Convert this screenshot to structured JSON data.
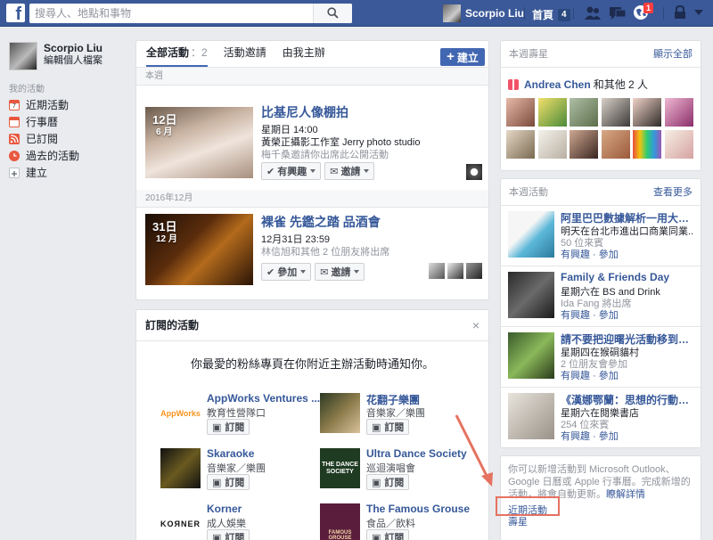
{
  "topbar": {
    "logo": "f",
    "search_placeholder": "搜尋人、地點和事物",
    "user_name": "Scorpio Liu",
    "home_label": "首頁",
    "home_count": "4",
    "notif_count": "1"
  },
  "sidebar": {
    "user_name": "Scorpio Liu",
    "edit_profile": "編輯個人檔案",
    "heading": "我的活動",
    "items": [
      {
        "label": "近期活動",
        "icon": "calendar-today-icon",
        "color": "#e9573f"
      },
      {
        "label": "行事曆",
        "icon": "calendar-icon",
        "color": "#e9573f"
      },
      {
        "label": "已訂閱",
        "icon": "rss-icon",
        "color": "#e9573f"
      },
      {
        "label": "過去的活動",
        "icon": "clock-icon",
        "color": "#e9573f"
      },
      {
        "label": "建立",
        "icon": "plus-icon",
        "color": "#90949c"
      }
    ]
  },
  "main": {
    "tabs": [
      {
        "label": "全部活動",
        "count": "：2"
      },
      {
        "label": "活動邀請",
        "count": ""
      },
      {
        "label": "由我主辦",
        "count": ""
      }
    ],
    "create_label": "建立",
    "sections": [
      {
        "label": "本週",
        "event": {
          "day": "12日",
          "month": "6 月",
          "title": "比基尼人像棚拍",
          "time": "星期日 14:00",
          "place": "黃榮正攝影工作室 Jerry photo studio",
          "invite": "梅千桑邀請你出席此公開活動",
          "btn1": "有興趣",
          "btn2": "邀請"
        }
      },
      {
        "label": "2016年12月",
        "event": {
          "day": "31日",
          "month": "12 月",
          "title": "裸雀 先鑑之踏 品酒會",
          "time": "12月31日 23:59",
          "invite": "林信旭和其他 2 位朋友將出席",
          "btn1": "參加",
          "btn2": "邀請"
        }
      }
    ]
  },
  "subscribed": {
    "title": "訂閱的活動",
    "close": "×",
    "promo": "你最愛的粉絲專頁在你附近主辦活動時通知你。",
    "subscribe_label": "訂閱",
    "pages": [
      {
        "name": "AppWorks Ventures ...",
        "category": "教育性營隊口",
        "thumb_text": "AppWorks"
      },
      {
        "name": "花翻子樂團",
        "category": "音樂家／樂團",
        "thumb_text": ""
      },
      {
        "name": "Skaraoke",
        "category": "音樂家／樂團",
        "thumb_text": ""
      },
      {
        "name": "Ultra Dance Society",
        "category": "巡迴演唱會",
        "thumb_text": "THE DANCE SOCIETY"
      },
      {
        "name": "Korner",
        "category": "成人娛樂",
        "thumb_text": "KOЯNER"
      },
      {
        "name": "The Famous Grouse",
        "category": "食品／飲料",
        "thumb_text": "FAMOUS GROUSE"
      }
    ]
  },
  "right": {
    "birthdays": {
      "heading": "本週壽星",
      "see_all": "顯示全部",
      "name": "Andrea Chen",
      "others": "和其他 2 人"
    },
    "events": {
      "heading": "本週活動",
      "see_more": "查看更多",
      "actions": "有興趣 · 參加",
      "items": [
        {
          "title": "阿里巴巴數據解析一用大數據...",
          "line1": "明天在台北市進出口商業同業...",
          "line2": "50 位來賓"
        },
        {
          "title": "Family & Friends Day",
          "line1": "星期六在 BS and Drink",
          "line2": "Ida Fang 將出席"
        },
        {
          "title": "請不要把迎曙光活動移到猴硐...",
          "line1": "星期四在猴硐貓村",
          "line2": "2 位朋友會參加"
        },
        {
          "title": "《漢娜鄂蘭：思想的行動》放...",
          "line1": "星期六在閱樂書店",
          "line2": "254 位來賓"
        }
      ]
    },
    "info": {
      "text": "你可以新增活動到 Microsoft Outlook、Google 日曆或 Apple 行事曆。完成新增的活動，將會自動更新。",
      "link": "瞭解詳情",
      "upcoming": "近期活動",
      "birthday": "壽星"
    }
  }
}
